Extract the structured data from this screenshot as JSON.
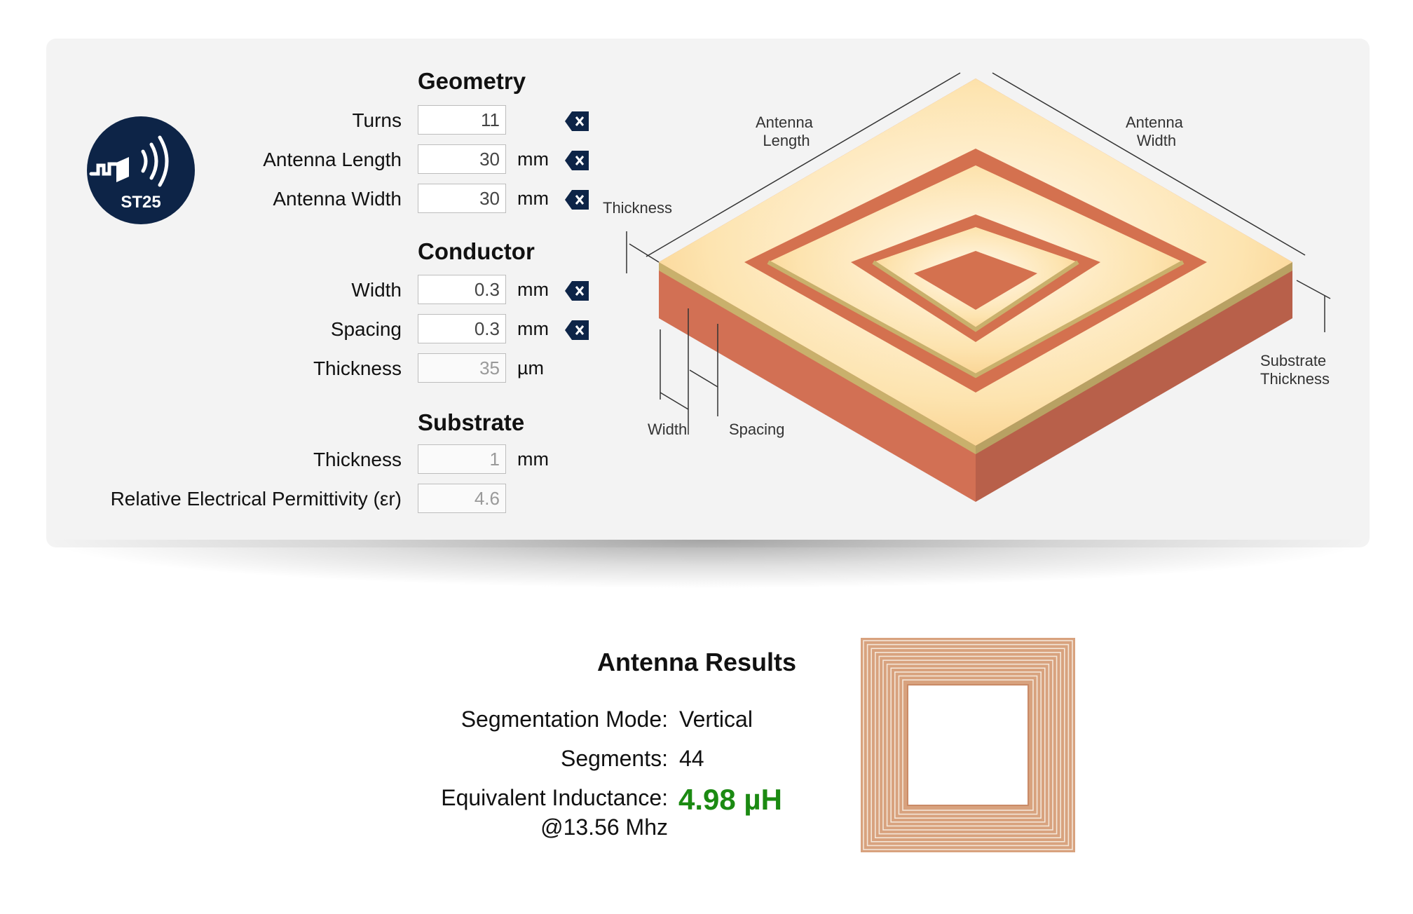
{
  "logo": {
    "text": "ST25",
    "icon": "nfc-st25-icon",
    "color": "#0d2447"
  },
  "geometry": {
    "title": "Geometry",
    "turns": {
      "label": "Turns",
      "value": "11"
    },
    "length": {
      "label": "Antenna Length",
      "value": "30",
      "unit": "mm"
    },
    "width": {
      "label": "Antenna Width",
      "value": "30",
      "unit": "mm"
    }
  },
  "conductor": {
    "title": "Conductor",
    "width": {
      "label": "Width",
      "value": "0.3",
      "unit": "mm"
    },
    "spacing": {
      "label": "Spacing",
      "value": "0.3",
      "unit": "mm"
    },
    "thickness": {
      "label": "Thickness",
      "value": "35",
      "unit": "µm"
    }
  },
  "substrate": {
    "title": "Substrate",
    "thickness": {
      "label": "Thickness",
      "value": "1",
      "unit": "mm"
    },
    "permittivity": {
      "label": "Relative Electrical Permittivity (εr)",
      "value": "4.6"
    }
  },
  "diagram": {
    "antenna_length": "Antenna Length",
    "antenna_length_l1": "Antenna",
    "antenna_length_l2": "Length",
    "antenna_width_l1": "Antenna",
    "antenna_width_l2": "Width",
    "thickness": "Thickness",
    "substrate_l1": "Substrate",
    "substrate_l2": "Thickness",
    "width": "Width",
    "spacing": "Spacing"
  },
  "results": {
    "title": "Antenna Results",
    "mode_label": "Segmentation Mode:",
    "mode_value": "Vertical",
    "segments_label": "Segments:",
    "segments_value": "44",
    "inductance_label": "Equivalent Inductance:",
    "inductance_sub": "@13.56 Mhz",
    "inductance_value": "4.98 µH",
    "inductance_color": "#1b8a12"
  },
  "colors": {
    "clear_button": "#0d2447",
    "copper": "#c96b4c",
    "trace_top": "#fde4b0"
  }
}
